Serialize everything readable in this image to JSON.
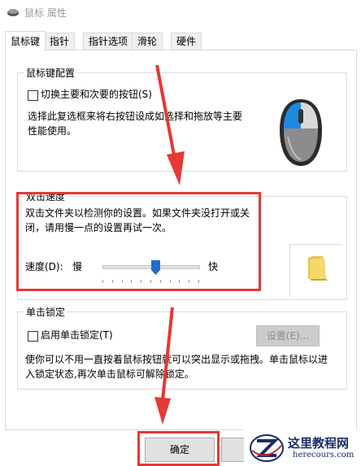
{
  "window": {
    "title": "鼠标 属性"
  },
  "tabs": [
    {
      "label": "鼠标键",
      "active": true
    },
    {
      "label": "指针",
      "active": false
    },
    {
      "label": "指针选项",
      "active": false
    },
    {
      "label": "滑轮",
      "active": false
    },
    {
      "label": "硬件",
      "active": false
    }
  ],
  "button_config": {
    "group_label": "鼠标键配置",
    "switch_label": "切换主要和次要的按钮(S)",
    "switch_checked": false,
    "description_line1": "选择此复选框来将右按钮设成如选择和拖放等主要",
    "description_line2": "性能使用。"
  },
  "double_click": {
    "group_label": "双击速度",
    "description_line1": "双击文件夹以检测你的设置。如果文件夹没打开或关",
    "description_line2": "闭，请用慢一点的设置再试一次。",
    "speed_label": "速度(D):",
    "slow_label": "慢",
    "fast_label": "快",
    "speed_level_fraction": 0.55
  },
  "click_lock": {
    "group_label": "单击锁定",
    "enable_label": "启用单击锁定(T)",
    "enable_checked": false,
    "settings_button": "设置(E)...",
    "description_line1": "使你可以不用一直按着鼠标按钮就可以突出显示或拖拽。单击鼠标以进",
    "description_line2": "入锁定状态,再次单击鼠标可解除锁定。"
  },
  "footer": {
    "ok_button": "确定"
  },
  "watermark": {
    "title": "这里教程网",
    "url": "herecours.com"
  },
  "icons": [
    "mouse-app-icon",
    "mouse-illustration-icon",
    "folder-icon",
    "slider-thumb-icon"
  ],
  "colors": {
    "annotation_red": "#e53935",
    "mouse_blue": "#1e88e5",
    "folder_yellow": "#f5d76e"
  }
}
